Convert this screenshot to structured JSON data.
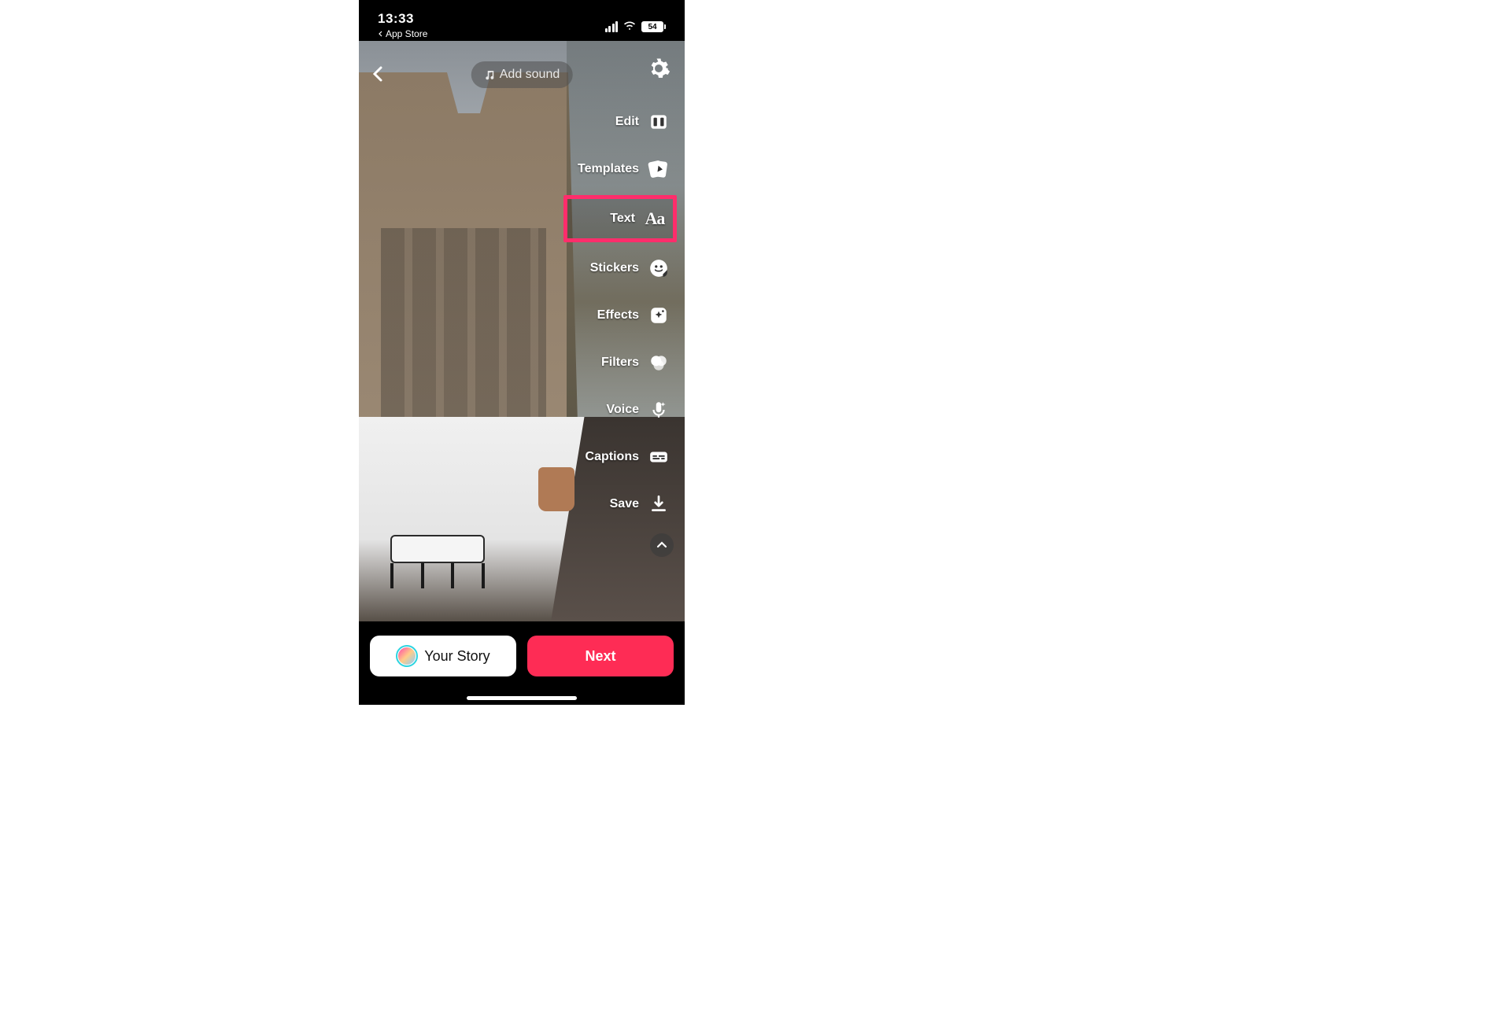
{
  "status": {
    "time": "13:33",
    "back_app": "App Store",
    "battery_level": "54"
  },
  "header": {
    "add_sound_label": "Add sound"
  },
  "tools": {
    "edit": "Edit",
    "templates": "Templates",
    "text": "Text",
    "stickers": "Stickers",
    "effects": "Effects",
    "filters": "Filters",
    "voice": "Voice",
    "captions": "Captions",
    "save": "Save"
  },
  "bottom": {
    "your_story": "Your Story",
    "next": "Next"
  },
  "highlighted_tool": "text",
  "colors": {
    "accent": "#fe2c55",
    "highlight_border": "#ff2d6b"
  }
}
